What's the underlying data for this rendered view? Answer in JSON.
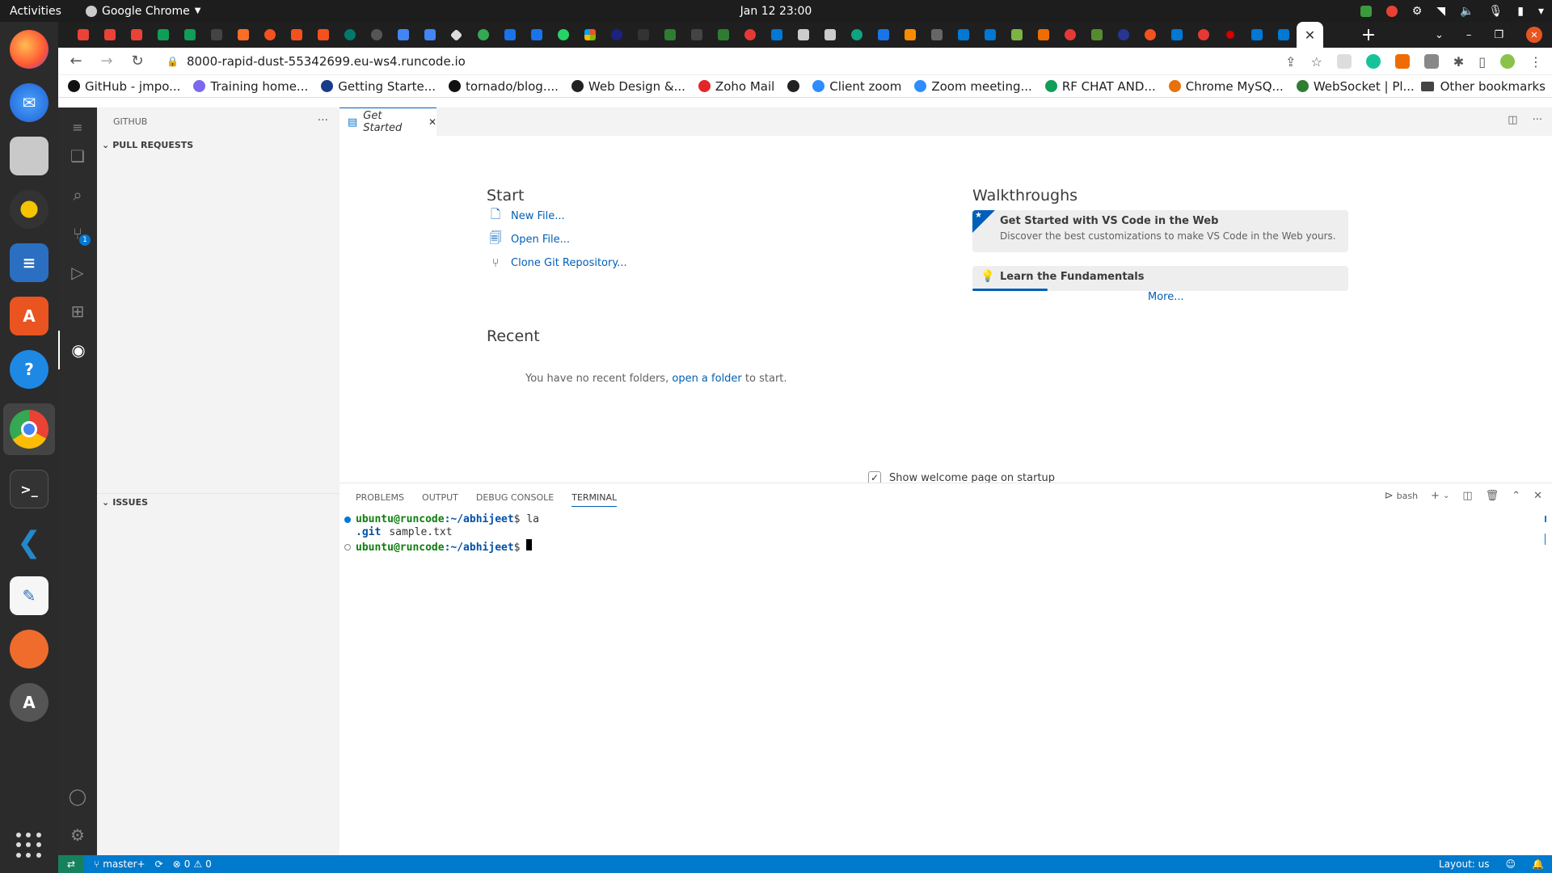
{
  "system": {
    "activities": "Activities",
    "app_name": "Google Chrome",
    "clock": "Jan 12  23:00"
  },
  "dock": {
    "apps": [
      "Firefox",
      "Thunderbird",
      "Files",
      "Rhythmbox",
      "LibreOffice Writer",
      "Ubuntu Software",
      "Help",
      "Google Chrome",
      "Terminal",
      "Visual Studio Code",
      "Text Editor",
      "Postman",
      "Software Updater"
    ]
  },
  "browser": {
    "url": "8000-rapid-dust-55342699.eu-ws4.runcode.io",
    "bookmarks": [
      {
        "label": "GitHub - jmpo...",
        "color": "#111111"
      },
      {
        "label": "Training home...",
        "color": "#7b68ee"
      },
      {
        "label": "Getting Starte...",
        "color": "#1a3a8a"
      },
      {
        "label": "tornado/blog....",
        "color": "#111111"
      },
      {
        "label": "Web Design &...",
        "color": "#222222"
      },
      {
        "label": "Zoho Mail",
        "color": "#e42527"
      },
      {
        "label": "",
        "color": "#222222"
      },
      {
        "label": "Client zoom",
        "color": "#2d8cff"
      },
      {
        "label": "Zoom meeting...",
        "color": "#2d8cff"
      },
      {
        "label": "RF CHAT AND...",
        "color": "#0f9d58"
      },
      {
        "label": "Chrome MySQ...",
        "color": "#e8710a"
      },
      {
        "label": "WebSocket | Pl...",
        "color": "#2e7d32"
      }
    ],
    "other_bookmarks": "Other bookmarks"
  },
  "vscode": {
    "sidebar_title": "GITHUB",
    "sections": {
      "pull_requests": "PULL REQUESTS",
      "issues": "ISSUES"
    },
    "scm_badge": "1",
    "tab_label": "Get Started",
    "welcome": {
      "start_heading": "Start",
      "new_file": "New File...",
      "open_file": "Open File...",
      "clone_repo": "Clone Git Repository...",
      "recent_heading": "Recent",
      "recent_text_before": "You have no recent folders,",
      "recent_link": "open a folder",
      "recent_text_after": "to start.",
      "walkthroughs_heading": "Walkthroughs",
      "walk1_title": "Get Started with VS Code in the Web",
      "walk1_desc": "Discover the best customizations to make VS Code in the Web yours.",
      "walk2_title": "Learn the Fundamentals",
      "walk2_progress": 0.2,
      "more": "More...",
      "show_on_startup": "Show welcome page on startup",
      "show_on_startup_checked": true
    },
    "panel": {
      "tabs": [
        "PROBLEMS",
        "OUTPUT",
        "DEBUG CONSOLE",
        "TERMINAL"
      ],
      "active_tab": "TERMINAL",
      "shell": "bash"
    },
    "terminal": {
      "user": "ubuntu@runcode",
      "path": ":~/abhijeet",
      "cmd1": "$ la",
      "output_git": ".git",
      "output_file": "sample.txt",
      "prompt_end": "$"
    },
    "status": {
      "branch": "master+",
      "errors": "0",
      "warnings": "0",
      "layout": "Layout: us"
    }
  }
}
